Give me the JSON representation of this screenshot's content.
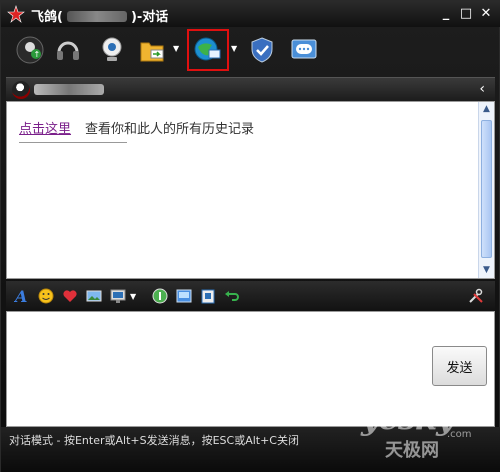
{
  "window": {
    "title_prefix": "飞鸽",
    "title_suffix": ")-对话",
    "title_paren": "("
  },
  "toolbar": {
    "icons": [
      "video-chat-icon",
      "voice-chat-icon",
      "webcam-icon",
      "send-file-icon",
      "remote-assist-icon",
      "security-icon",
      "message-history-icon"
    ]
  },
  "history": {
    "link_label": "点击这里",
    "description": "查看你和此人的所有历史记录"
  },
  "format_toolbar": {
    "icons": [
      "font-icon",
      "emoticon-icon",
      "heart-icon",
      "image-icon",
      "screenshot-icon",
      "chat-bubble-icon",
      "picture-icon",
      "clipboard-icon",
      "undo-icon",
      "settings-icon"
    ]
  },
  "input": {
    "send_label": "发送"
  },
  "status": {
    "text": "对话模式 - 按Enter或Alt+S发送消息，按ESC或Alt+C关闭"
  },
  "watermark": {
    "line1": "yesky",
    "line2": "天极网",
    "suffix": ".com"
  },
  "colors": {
    "highlight": "#e01010",
    "link": "#7a1f8a"
  }
}
